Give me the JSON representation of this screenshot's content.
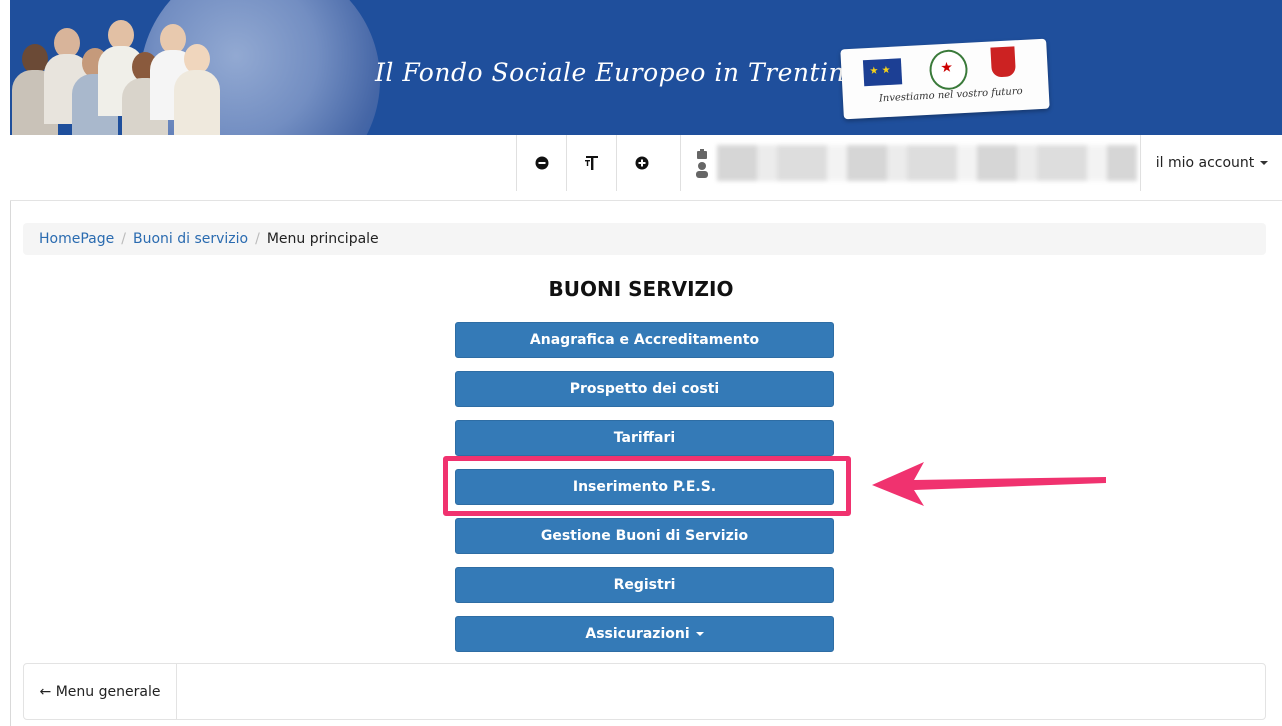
{
  "header": {
    "title": "Il Fondo Sociale Europeo in Trentino",
    "motto": "Investiamo nel vostro futuro",
    "brand_color": "#1f4f9c"
  },
  "toolbar": {
    "decrease_font_icon": "minus-circle-icon",
    "font_size_icon": "text-size-icon",
    "increase_font_icon": "plus-circle-icon",
    "user_icon": "user-briefcase-icon",
    "account_label": "il mio account"
  },
  "breadcrumb": {
    "items": [
      "HomePage",
      "Buoni di servizio",
      "Menu principale"
    ]
  },
  "main": {
    "title": "BUONI SERVIZIO",
    "buttons": [
      "Anagrafica e Accreditamento",
      "Prospetto dei costi",
      "Tariffari",
      "Inserimento P.E.S.",
      "Gestione Buoni di Servizio",
      "Registri",
      "Assicurazioni"
    ],
    "button_color": "#347ab7",
    "highlight_color": "#f0326f"
  },
  "footer": {
    "back_label": "← Menu generale"
  }
}
